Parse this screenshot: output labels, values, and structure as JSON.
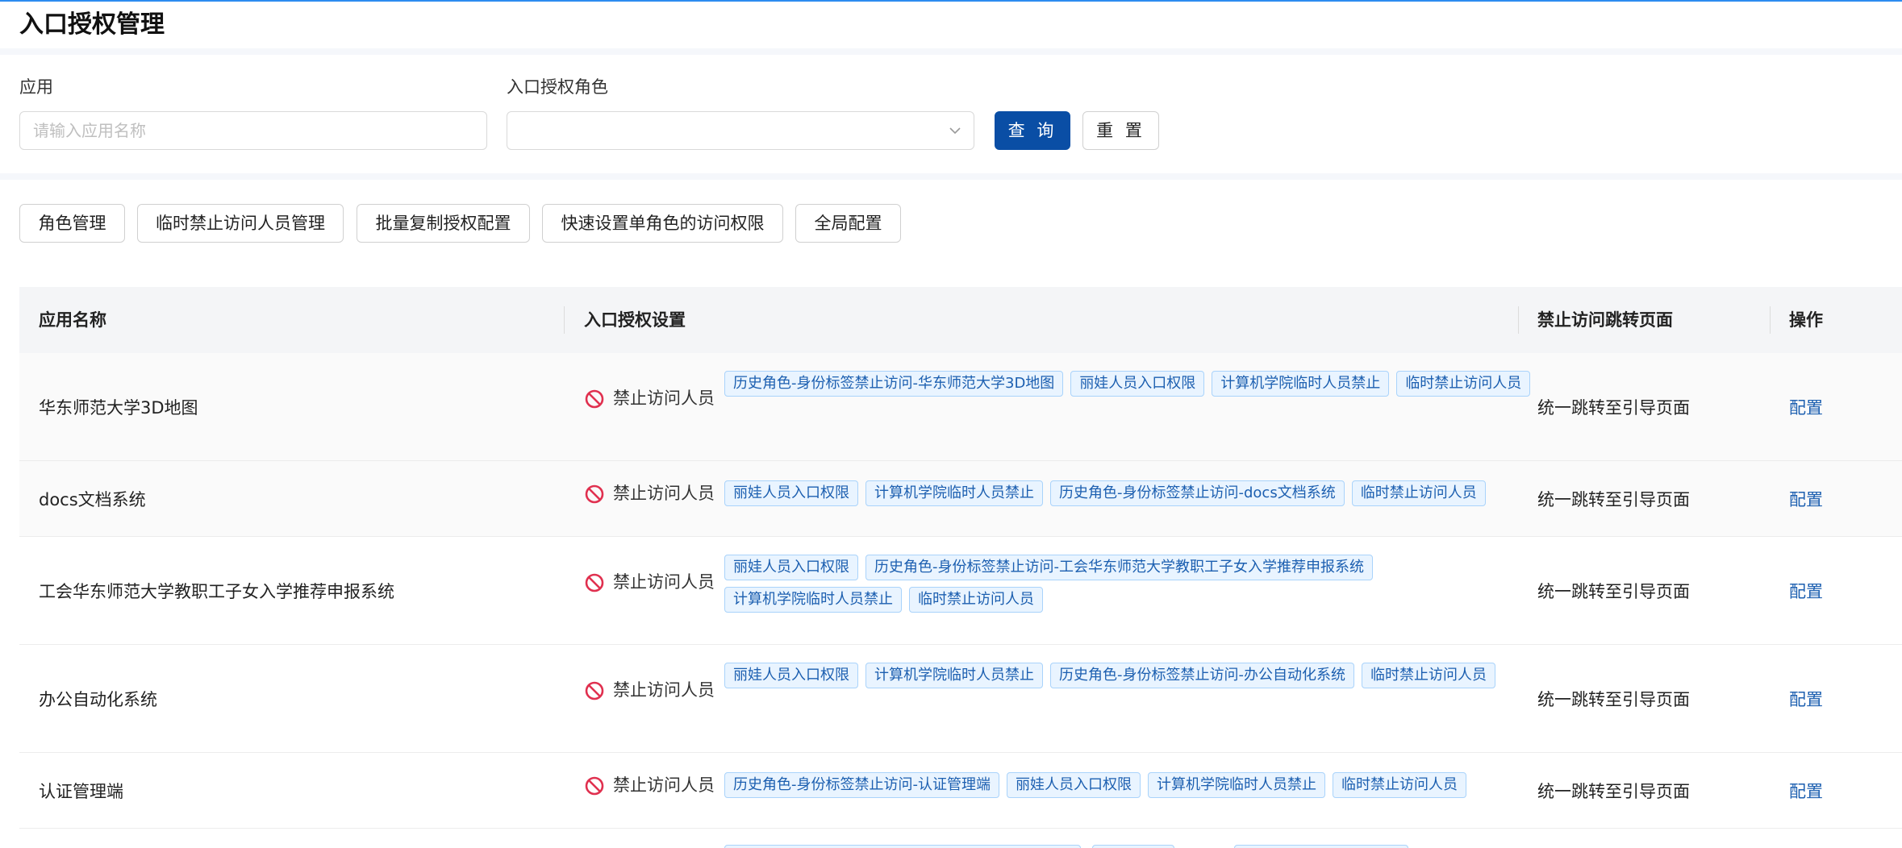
{
  "page": {
    "title": "入口授权管理"
  },
  "search": {
    "app_label": "应用",
    "app_placeholder": "请输入应用名称",
    "role_label": "入口授权角色",
    "role_value": "",
    "query_button": "查 询",
    "reset_button": "重 置"
  },
  "toolbar": {
    "buttons": [
      {
        "label": "角色管理"
      },
      {
        "label": "临时禁止访问人员管理"
      },
      {
        "label": "批量复制授权配置"
      },
      {
        "label": "快速设置单角色的访问权限"
      },
      {
        "label": "全局配置"
      }
    ]
  },
  "table": {
    "columns": [
      "应用名称",
      "入口授权设置",
      "禁止访问跳转页面",
      "操作"
    ],
    "rows": [
      {
        "app": "华东师范大学3D地图",
        "ban_label": "禁止访问人员",
        "tags": [
          "历史角色-身份标签禁止访问-华东师范大学3D地图",
          "丽娃人员入口权限",
          "计算机学院临时人员禁止",
          "临时禁止访问人员"
        ],
        "redirect": "统一跳转至引导页面",
        "action": "配置"
      },
      {
        "app": "docs文档系统",
        "ban_label": "禁止访问人员",
        "tags": [
          "丽娃人员入口权限",
          "计算机学院临时人员禁止",
          "历史角色-身份标签禁止访问-docs文档系统",
          "临时禁止访问人员"
        ],
        "redirect": "统一跳转至引导页面",
        "action": "配置"
      },
      {
        "app": "工会华东师范大学教职工子女入学推荐申报系统",
        "ban_label": "禁止访问人员",
        "tags": [
          "丽娃人员入口权限",
          "历史角色-身份标签禁止访问-工会华东师范大学教职工子女入学推荐申报系统",
          "计算机学院临时人员禁止",
          "临时禁止访问人员"
        ],
        "redirect": "统一跳转至引导页面",
        "action": "配置"
      },
      {
        "app": "办公自动化系统",
        "ban_label": "禁止访问人员",
        "tags": [
          "丽娃人员入口权限",
          "计算机学院临时人员禁止",
          "历史角色-身份标签禁止访问-办公自动化系统",
          "临时禁止访问人员"
        ],
        "redirect": "统一跳转至引导页面",
        "action": "配置"
      },
      {
        "app": "认证管理端",
        "ban_label": "禁止访问人员",
        "tags": [
          "历史角色-身份标签禁止访问-认证管理端",
          "丽娃人员入口权限",
          "计算机学院临时人员禁止",
          "临时禁止访问人员"
        ],
        "redirect": "统一跳转至引导页面",
        "action": "配置"
      }
    ]
  },
  "colors": {
    "primary": "#0a4ea5",
    "link": "#1c5fb0",
    "tag_bg": "#e9f4ff",
    "tag_border": "#a9d3fb",
    "ban_icon": "#e0304f"
  }
}
